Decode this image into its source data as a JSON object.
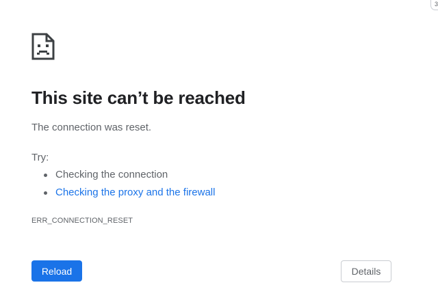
{
  "badge_text": "3",
  "error_page": {
    "icon": "sad-page-icon",
    "title": "This site can’t be reached",
    "message": "The connection was reset.",
    "try_label": "Try:",
    "suggestions": [
      {
        "text": "Checking the connection",
        "is_link": false
      },
      {
        "text": "Checking the proxy and the firewall",
        "is_link": true
      }
    ],
    "error_code": "ERR_CONNECTION_RESET"
  },
  "buttons": {
    "reload_label": "Reload",
    "details_label": "Details"
  },
  "colors": {
    "primary_button": "#1a73e8",
    "link": "#1a73e8",
    "title_text": "#202124",
    "body_text": "#5f6368"
  }
}
